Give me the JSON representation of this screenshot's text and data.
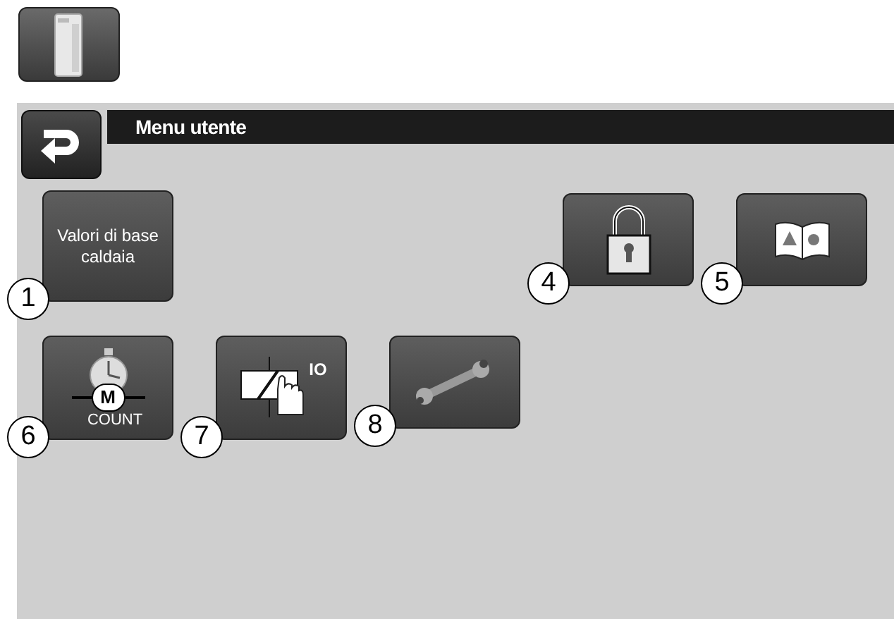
{
  "title": "Menu utente",
  "tiles": [
    {
      "number": "1",
      "kind": "text",
      "label": "Valori di base caldaia"
    },
    {
      "number": "4",
      "kind": "lock"
    },
    {
      "number": "5",
      "kind": "manual"
    },
    {
      "number": "6",
      "kind": "counter",
      "badge": "M",
      "caption": "COUNT"
    },
    {
      "number": "7",
      "kind": "relay",
      "caption": "IO"
    },
    {
      "number": "8",
      "kind": "wrench"
    }
  ]
}
